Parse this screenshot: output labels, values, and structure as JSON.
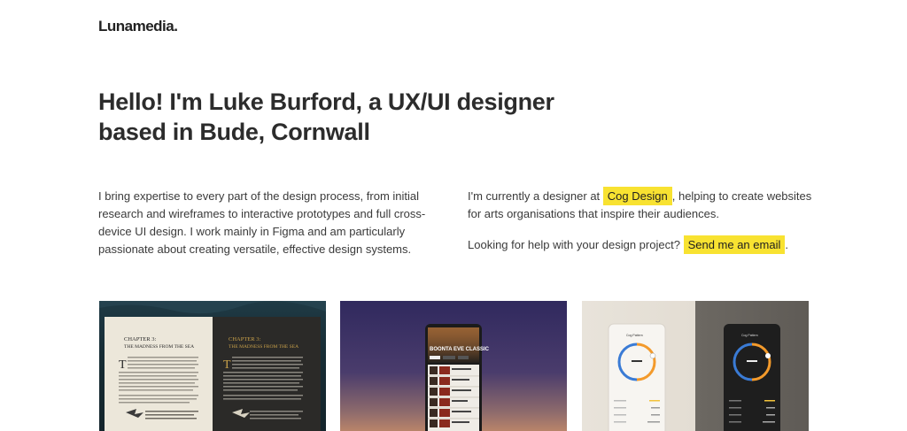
{
  "header": {
    "logo": "Lunamedia."
  },
  "hero": {
    "headline_line1": "Hello! I'm Luke Burford, a UX/UI designer",
    "headline_line2": "based in Bude, Cornwall"
  },
  "intro": {
    "text": "I bring expertise to every part of the design process, from initial research and wireframes to interactive prototypes and full cross-device UI design. I work mainly in Figma and am particularly passionate about creating versatile, effective design systems."
  },
  "current": {
    "prefix": "I'm currently a designer at",
    "company_link": "Cog Design",
    "suffix": ", helping to create websites for arts organisations that inspire their audiences.",
    "help_prefix": "Looking for help with your design project?",
    "email_link": "Send me an email",
    "help_suffix": "."
  },
  "portfolio": {
    "card1": {
      "chapter": "CHAPTER 3:",
      "chapter_title": "THE MADNESS FROM THE SEA"
    },
    "card2": {
      "event_title": "BOONTA EVE CLASSIC"
    },
    "card3": {
      "panel_title": "Cog Pattern"
    }
  }
}
